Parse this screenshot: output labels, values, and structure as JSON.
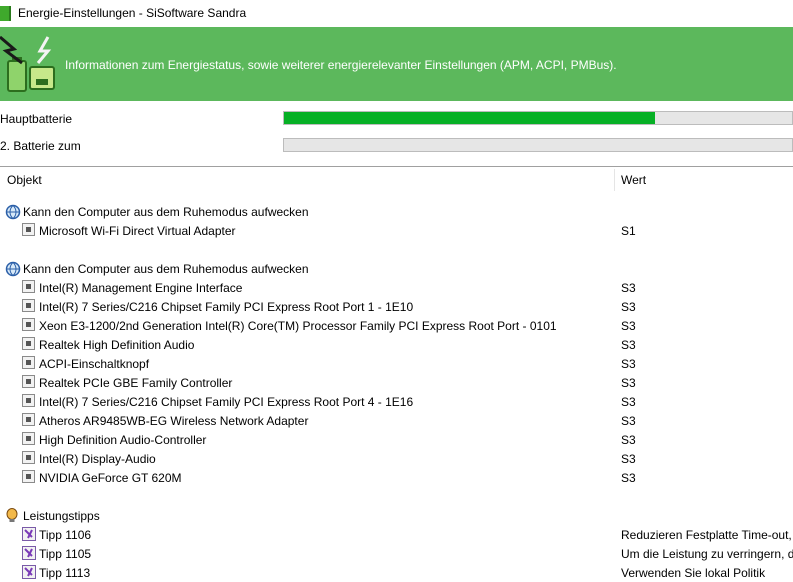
{
  "window": {
    "title": "Energie-Einstellungen - SiSoftware Sandra"
  },
  "banner": {
    "text": "Informationen zum Energiestatus, sowie weiterer energierelevanter Einstellungen (APM, ACPI, PMBus)."
  },
  "batteries": [
    {
      "label": "Hauptbatterie",
      "level_percent": 73
    },
    {
      "label": "2. Batterie zum",
      "level_percent": 0
    }
  ],
  "columns": {
    "object": "Objekt",
    "value": "Wert"
  },
  "groups": [
    {
      "title": "Kann den Computer aus dem Ruhemodus aufwecken",
      "icon": "globe-icon",
      "items": [
        {
          "name": "Microsoft Wi-Fi Direct Virtual Adapter",
          "value": "S1"
        }
      ]
    },
    {
      "title": "Kann den Computer aus dem Ruhemodus aufwecken",
      "icon": "globe-icon",
      "items": [
        {
          "name": "Intel(R) Management Engine Interface",
          "value": "S3"
        },
        {
          "name": "Intel(R) 7 Series/C216 Chipset Family PCI Express Root Port 1 - 1E10",
          "value": "S3"
        },
        {
          "name": "Xeon E3-1200/2nd Generation Intel(R) Core(TM) Processor Family PCI Express Root Port - 0101",
          "value": "S3"
        },
        {
          "name": "Realtek High Definition Audio",
          "value": "S3"
        },
        {
          "name": "ACPI-Einschaltknopf",
          "value": "S3"
        },
        {
          "name": "Realtek PCIe GBE Family Controller",
          "value": "S3"
        },
        {
          "name": "Intel(R) 7 Series/C216 Chipset Family PCI Express Root Port 4 - 1E16",
          "value": "S3"
        },
        {
          "name": "Atheros AR9485WB-EG Wireless Network Adapter",
          "value": "S3"
        },
        {
          "name": "High Definition Audio-Controller",
          "value": "S3"
        },
        {
          "name": "Intel(R) Display-Audio",
          "value": "S3"
        },
        {
          "name": "NVIDIA GeForce GT 620M",
          "value": "S3"
        }
      ]
    },
    {
      "title": "Leistungstipps",
      "icon": "lightbulb-icon",
      "items": [
        {
          "name": "Tipp 1106",
          "value": "Reduzieren Festplatte Time-out, "
        },
        {
          "name": "Tipp 1105",
          "value": "Um die Leistung zu verringern, d"
        },
        {
          "name": "Tipp 1113",
          "value": "Verwenden Sie lokal Politik"
        }
      ]
    }
  ]
}
